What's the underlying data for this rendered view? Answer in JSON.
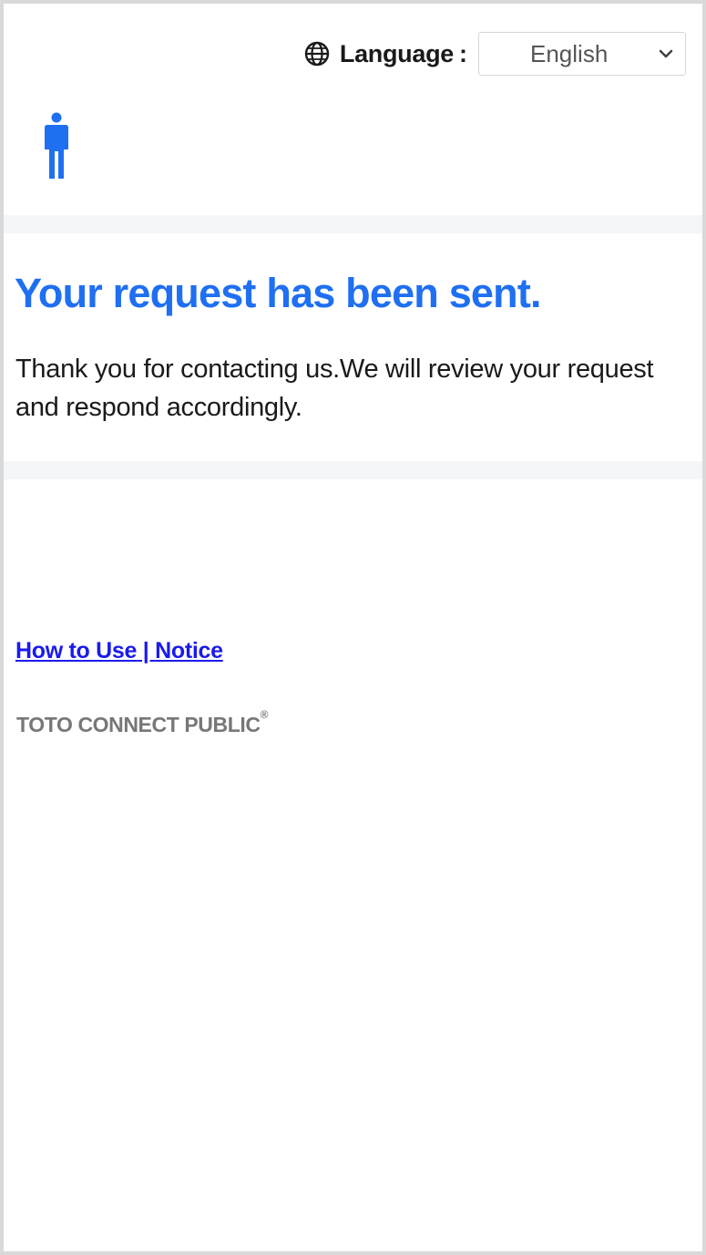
{
  "header": {
    "language_label": "Language",
    "language_colon": ":",
    "language_selected": "English",
    "language_icon": "globe-icon",
    "selector_icon": "chevron-down-icon"
  },
  "logo": {
    "icon": "person-icon",
    "color": "#1f6ff2"
  },
  "main": {
    "headline": "Your request has been sent.",
    "message": "Thank you for contacting us.We will review your request and respond accordingly."
  },
  "footer": {
    "links": [
      {
        "label": "How to Use"
      },
      {
        "label": "Notice"
      }
    ],
    "separator": " | ",
    "brand": "TOTO CONNECT PUBLIC",
    "brand_mark": "®"
  },
  "colors": {
    "accent": "#1f6ff2",
    "link": "#1a1aee",
    "brand_text": "#777777",
    "band": "#f5f6f8"
  }
}
